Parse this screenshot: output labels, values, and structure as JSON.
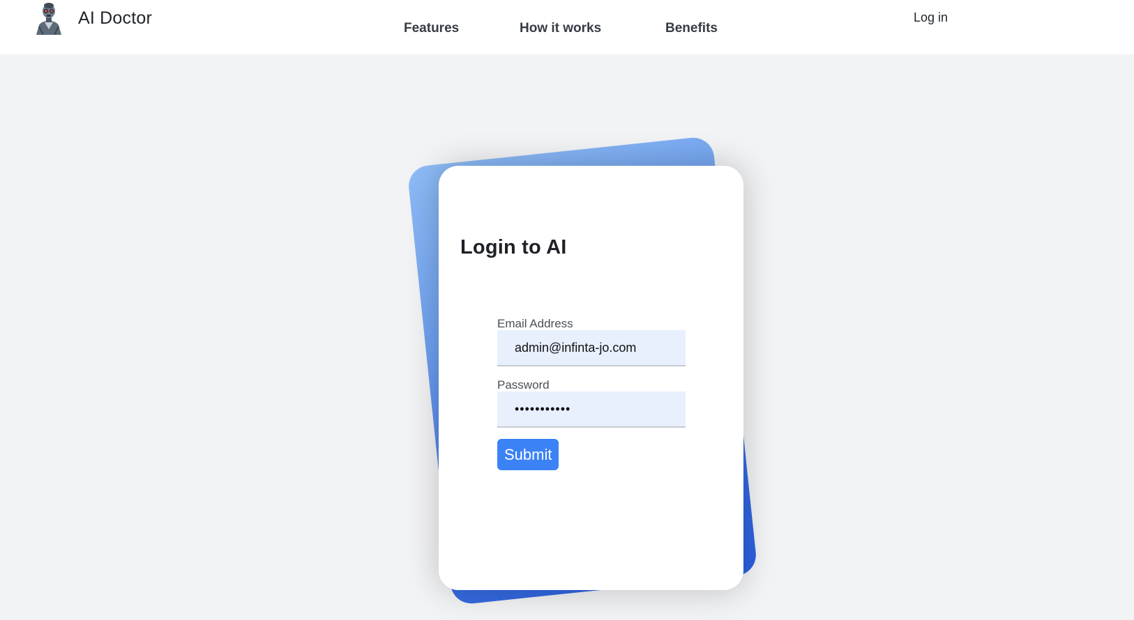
{
  "header": {
    "brand_name": "AI Doctor",
    "nav": {
      "features": "Features",
      "how_it_works": "How it works",
      "benefits": "Benefits"
    },
    "login_link": "Log in"
  },
  "login_card": {
    "title": "Login to AI",
    "email_label": "Email Address",
    "email_value": "admin@infinta-jo.com",
    "password_label": "Password",
    "password_value": "•••••••••••",
    "submit_label": "Submit"
  },
  "colors": {
    "accent": "#3b82f6",
    "page_background": "#f2f3f5",
    "input_background": "#e8f0fd"
  },
  "icons": {
    "avatar": "robot-doctor-avatar"
  }
}
